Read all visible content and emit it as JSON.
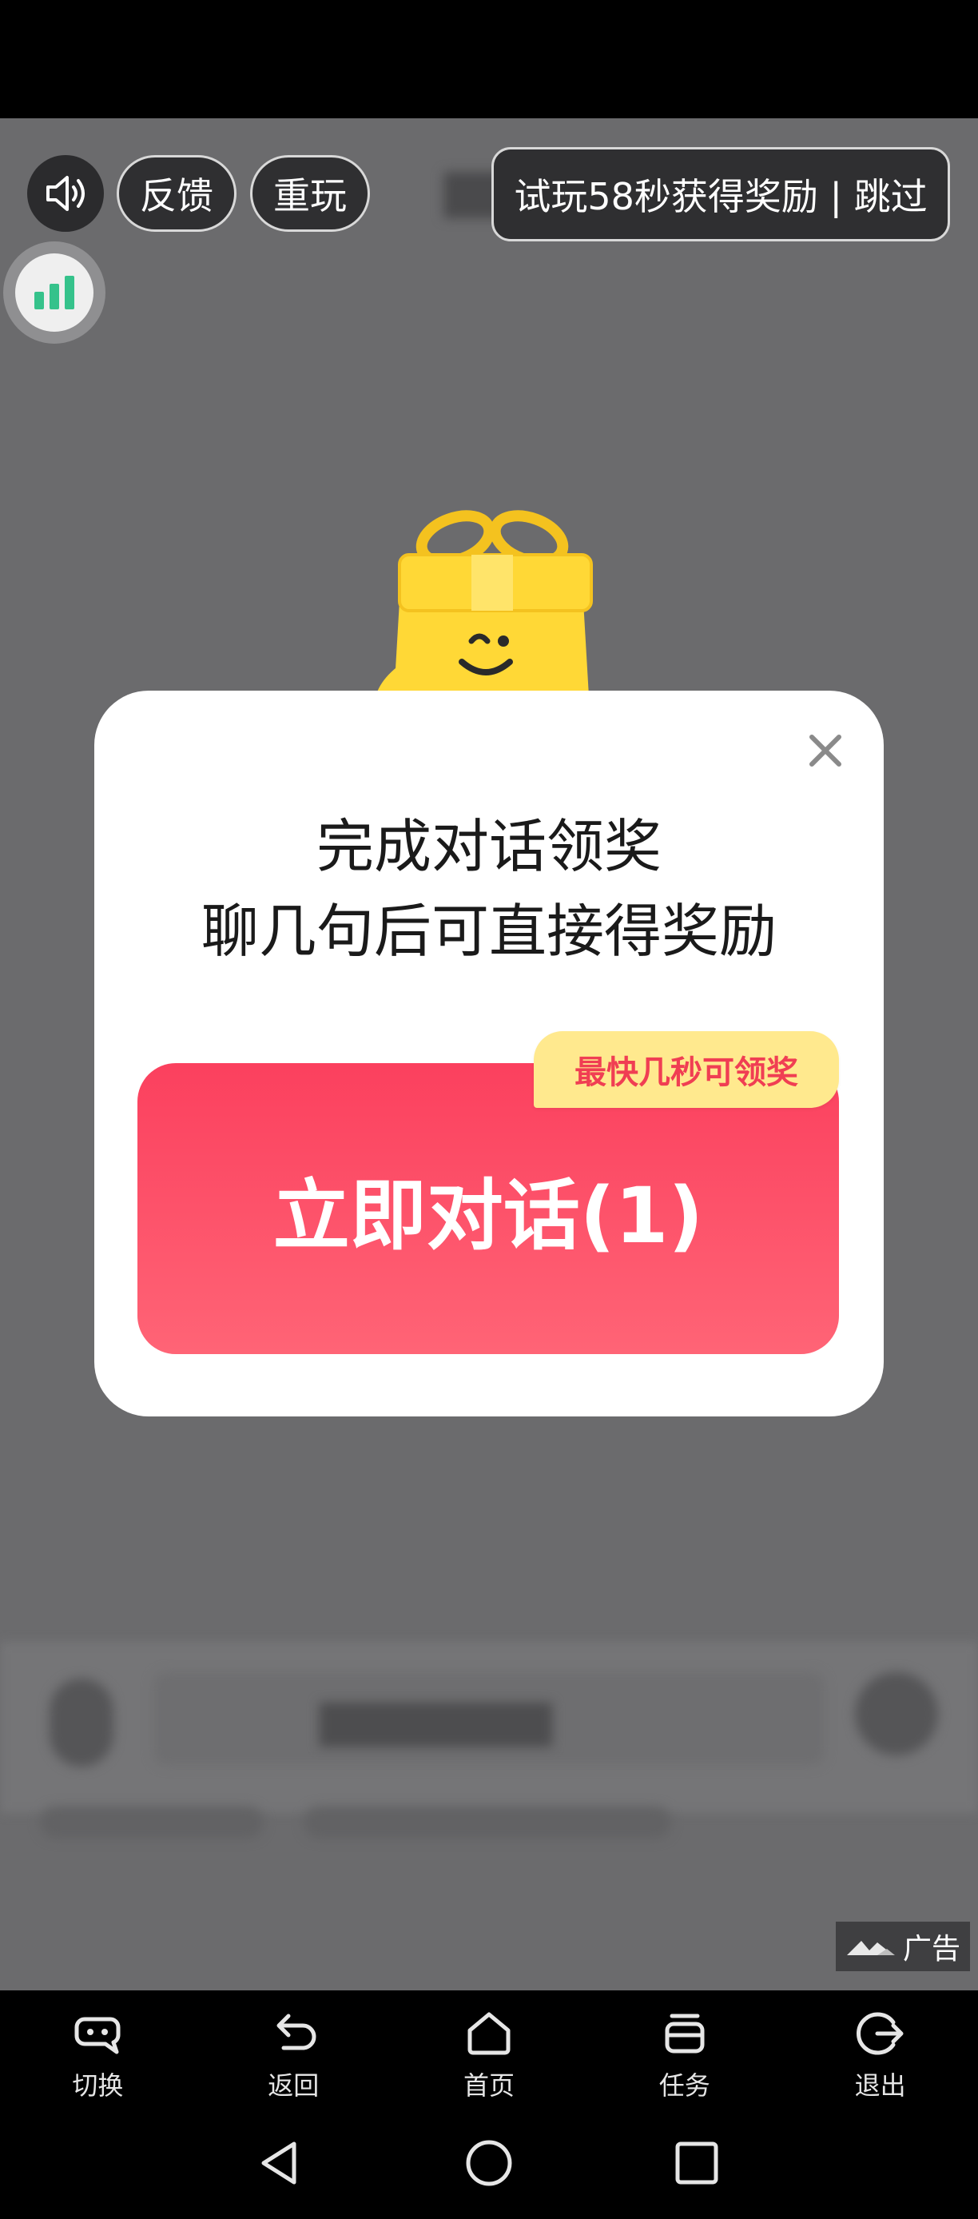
{
  "top_controls": {
    "feedback_label": "反馈",
    "replay_label": "重玩",
    "skip_label": "试玩58秒获得奖励 | 跳过"
  },
  "dialog": {
    "line1": "完成对话领奖",
    "line2": "聊几句后可直接得奖励",
    "tip": "最快几秒可领奖",
    "cta_label": "立即对话(1)"
  },
  "ad_badge": {
    "label": "广告"
  },
  "bottom_nav": {
    "items": [
      {
        "label": "切换",
        "icon": "switch-icon"
      },
      {
        "label": "返回",
        "icon": "back-arrow-icon"
      },
      {
        "label": "首页",
        "icon": "home-icon"
      },
      {
        "label": "任务",
        "icon": "task-icon"
      },
      {
        "label": "退出",
        "icon": "exit-icon"
      }
    ]
  },
  "colors": {
    "overlay": "#6b6b6d",
    "cta_top": "#fb405e",
    "cta_bottom": "#ff6476",
    "tip_bg": "#ffe98e",
    "tip_text": "#f03e53",
    "stats_bars": "#35c28b"
  }
}
